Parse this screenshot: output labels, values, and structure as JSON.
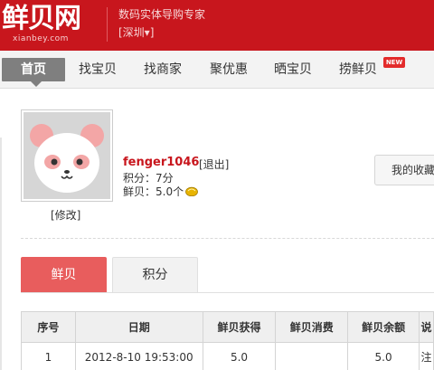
{
  "header": {
    "logo_text": "鲜贝网",
    "logo_domain": "xianbey.com",
    "tagline": "数码实体导购专家",
    "city": "[深圳▾]"
  },
  "nav": {
    "items": [
      {
        "label": "首页",
        "active": true
      },
      {
        "label": "找宝贝"
      },
      {
        "label": "找商家"
      },
      {
        "label": "聚优惠"
      },
      {
        "label": "晒宝贝"
      },
      {
        "label": "捞鲜贝",
        "badge": "NEW"
      }
    ]
  },
  "profile": {
    "edit_label": "[修改]",
    "username": "fenger1046",
    "logout_label": "[退出]",
    "score_text": "积分：7分",
    "shell_text": "鲜贝：5.0个",
    "favorites_button": "我的收藏"
  },
  "tabs": [
    {
      "label": "鲜贝",
      "active": true
    },
    {
      "label": "积分"
    }
  ],
  "table": {
    "headers": [
      "序号",
      "日期",
      "鲜贝获得",
      "鲜贝消费",
      "鲜贝余额",
      "说"
    ],
    "rows": [
      [
        "1",
        "2012-8-10 19:53:00",
        "5.0",
        "",
        "5.0",
        "注"
      ]
    ]
  },
  "colors": {
    "brand_red": "#c8161d",
    "tab_active": "#e85d5d"
  }
}
